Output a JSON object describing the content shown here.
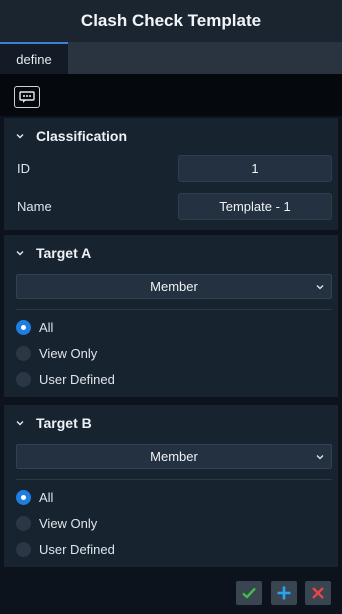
{
  "window": {
    "title": "Clash Check Template"
  },
  "tabs": [
    {
      "label": "define",
      "active": true
    }
  ],
  "toolbar": {
    "icon": "comment-icon"
  },
  "classification": {
    "title": "Classification",
    "id_label": "ID",
    "id_value": "1",
    "name_label": "Name",
    "name_value": "Template - 1"
  },
  "target_a": {
    "title": "Target A",
    "select_value": "Member",
    "options": [
      {
        "label": "All",
        "selected": true
      },
      {
        "label": "View Only",
        "selected": false
      },
      {
        "label": "User Defined",
        "selected": false
      }
    ]
  },
  "target_b": {
    "title": "Target B",
    "select_value": "Member",
    "options": [
      {
        "label": "All",
        "selected": true
      },
      {
        "label": "View Only",
        "selected": false
      },
      {
        "label": "User Defined",
        "selected": false
      }
    ]
  },
  "footer": {
    "confirm_icon": "check-icon",
    "add_icon": "plus-icon",
    "close_icon": "close-icon"
  },
  "colors": {
    "accent": "#1e7fe0",
    "confirm": "#3fbf4a",
    "add": "#2aa3f0",
    "close": "#e84545"
  }
}
